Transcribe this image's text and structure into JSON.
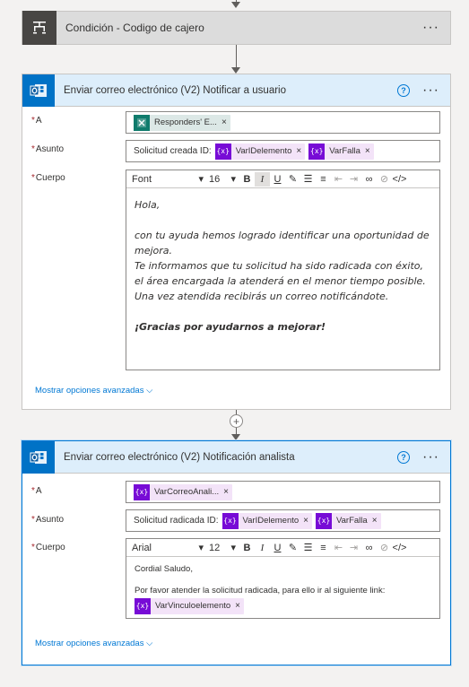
{
  "condition": {
    "title": "Condición - Codigo de cajero"
  },
  "card1": {
    "title": "Enviar correo electrónico (V2) Notificar a usuario",
    "to": {
      "label": "A",
      "token": "Responders' E..."
    },
    "subject": {
      "label": "Asunto",
      "prefix": "Solicitud creada ID:",
      "tokens": [
        "VarIDelemento",
        "VarFalla"
      ]
    },
    "body": {
      "label": "Cuerpo",
      "font": "Font",
      "size": "16",
      "lines": [
        "Hola,",
        "con tu ayuda hemos logrado identificar una oportunidad de mejora.",
        "Te informamos que tu solicitud ha sido radicada con éxito,",
        "el área encargada la atenderá en el menor tiempo posible.",
        "Una vez atendida recibirás un correo notificándote.",
        "¡Gracias por ayudarnos a mejorar!"
      ]
    },
    "advanced": "Mostrar opciones avanzadas"
  },
  "card2": {
    "title": "Enviar correo electrónico (V2) Notificación analista",
    "to": {
      "label": "A",
      "token": "VarCorreoAnali..."
    },
    "subject": {
      "label": "Asunto",
      "prefix": "Solicitud radicada ID:",
      "tokens": [
        "VarIDelemento",
        "VarFalla"
      ]
    },
    "body": {
      "label": "Cuerpo",
      "font": "Arial",
      "size": "12",
      "lines": [
        "Cordial Saludo,",
        "Por favor atender la solicitud radicada, para ello ir al siguiente link:"
      ],
      "token": "VarVinculoelemento"
    },
    "advanced": "Mostrar opciones avanzadas"
  },
  "glyphs": {
    "more": "···",
    "help": "?",
    "close": "×",
    "expr": "{x}",
    "chevron": "⌄",
    "required": "*"
  },
  "colors": {
    "accent": "#0078d4",
    "token_purple": "#770bd6",
    "outlook_blue": "#0072c6"
  }
}
